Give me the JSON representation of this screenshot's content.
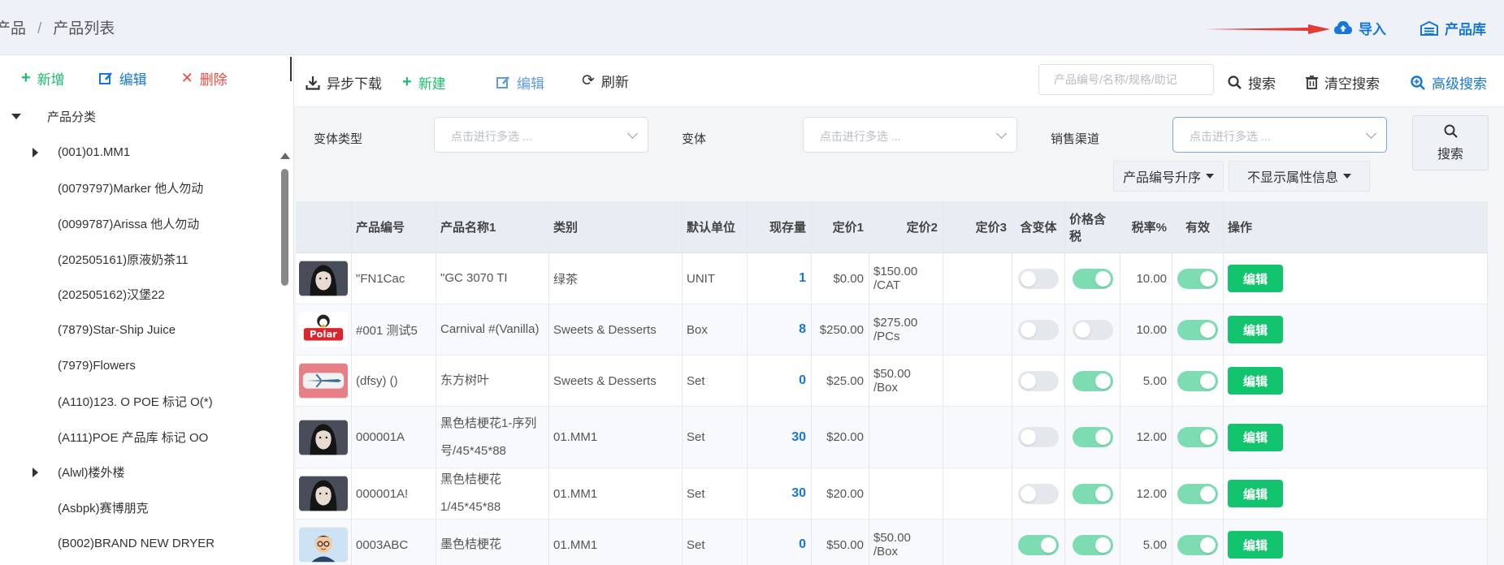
{
  "breadcrumb": {
    "parent": "产品",
    "current": "产品列表"
  },
  "top_actions": {
    "import_label": "导入",
    "library_label": "产品库"
  },
  "colors": {
    "accent": "#1677d8",
    "green": "#12c46e",
    "danger": "#e54d42",
    "arrow": "#e53935"
  },
  "sidebar": {
    "actions": {
      "add": "新增",
      "edit": "编辑",
      "delete": "删除"
    },
    "tree": [
      {
        "label": "产品分类",
        "level": 0,
        "expander": "expanded"
      },
      {
        "label": "(001)01.MM1",
        "level": 1,
        "expander": "collapsed"
      },
      {
        "label": "(0079797)Marker 他人勿动",
        "level": 1,
        "expander": "none"
      },
      {
        "label": "(0099787)Arissa 他人勿动",
        "level": 1,
        "expander": "none"
      },
      {
        "label": "(202505161)原液奶茶11",
        "level": 1,
        "expander": "none"
      },
      {
        "label": "(202505162)汉堡22",
        "level": 1,
        "expander": "none"
      },
      {
        "label": "(7879)Star-Ship Juice",
        "level": 1,
        "expander": "none"
      },
      {
        "label": "(7979)Flowers",
        "level": 1,
        "expander": "none"
      },
      {
        "label": "(A110)123. O POE 标记 O(*)",
        "level": 1,
        "expander": "none"
      },
      {
        "label": "(A111)POE 产品库 标记 OO",
        "level": 1,
        "expander": "none"
      },
      {
        "label": "(Alwl)楼外楼",
        "level": 1,
        "expander": "collapsed"
      },
      {
        "label": "(Asbpk)赛博朋克",
        "level": 1,
        "expander": "none"
      },
      {
        "label": "(B002)BRAND NEW DRYER",
        "level": 1,
        "expander": "none"
      }
    ]
  },
  "toolbar": {
    "async_download": "异步下载",
    "new": "新建",
    "edit": "编辑",
    "refresh": "刷新",
    "search_placeholder": "产品编号/名称/规格/助记",
    "search": "搜索",
    "clear_search": "清空搜索",
    "advanced_search": "高级搜索"
  },
  "filters": {
    "variant_type_label": "变体类型",
    "variant_label": "变体",
    "channel_label": "销售渠道",
    "select_placeholder": "点击进行多选 ...",
    "search_button": "搜索",
    "sort_button": "产品编号升序",
    "attr_button": "不显示属性信息"
  },
  "table": {
    "columns": [
      "产品编号",
      "产品名称1",
      "类别",
      "默认单位",
      "现存量",
      "定价1",
      "定价2",
      "定价3",
      "含变体",
      "价格含税",
      "税率%",
      "有效",
      "操作"
    ],
    "edit_label": "编辑",
    "rows": [
      {
        "thumb": "portrait",
        "code": "\"FN1Cac",
        "name": "\"GC 3070 TI",
        "category": "绿茶",
        "unit": "UNIT",
        "stock": "1",
        "price1": "$0.00",
        "price2": "$150.00 /CAT",
        "price3": "",
        "variant": false,
        "tax_incl": true,
        "tax_rate": "10.00",
        "valid": true,
        "tall": false
      },
      {
        "thumb": "polar-logo",
        "code": "#001 测试5",
        "name": "Carnival #(Vanilla)",
        "category": "Sweets & Desserts",
        "unit": "Box",
        "stock": "8",
        "price1": "$250.00",
        "price2": "$275.00 /PCs",
        "price3": "",
        "variant": false,
        "tax_incl": false,
        "tax_rate": "10.00",
        "valid": true,
        "tall": false
      },
      {
        "thumb": "airplane",
        "code": "(dfsy) ()",
        "name": "东方树叶",
        "category": "Sweets & Desserts",
        "unit": "Set",
        "stock": "0",
        "price1": "$25.00",
        "price2": "$50.00 /Box",
        "price3": "",
        "variant": false,
        "tax_incl": true,
        "tax_rate": "5.00",
        "valid": true,
        "tall": false
      },
      {
        "thumb": "portrait",
        "code": "000001A",
        "name": "黑色桔梗花1-序列号/45*45*88",
        "category": "01.MM1",
        "unit": "Set",
        "stock": "30",
        "price1": "$20.00",
        "price2": "",
        "price3": "",
        "variant": false,
        "tax_incl": true,
        "tax_rate": "12.00",
        "valid": true,
        "tall": true
      },
      {
        "thumb": "portrait",
        "code": "000001A!",
        "name": "黑色桔梗花1/45*45*88",
        "category": "01.MM1",
        "unit": "Set",
        "stock": "30",
        "price1": "$20.00",
        "price2": "",
        "price3": "",
        "variant": false,
        "tax_incl": true,
        "tax_rate": "12.00",
        "valid": true,
        "tall": false
      },
      {
        "thumb": "cartoon-avatar",
        "code": "0003ABC",
        "name": "墨色桔梗花",
        "category": "01.MM1",
        "unit": "Set",
        "stock": "0",
        "price1": "$50.00",
        "price2": "$50.00 /Box",
        "price3": "",
        "variant": true,
        "tax_incl": true,
        "tax_rate": "5.00",
        "valid": true,
        "tall": false
      }
    ]
  }
}
